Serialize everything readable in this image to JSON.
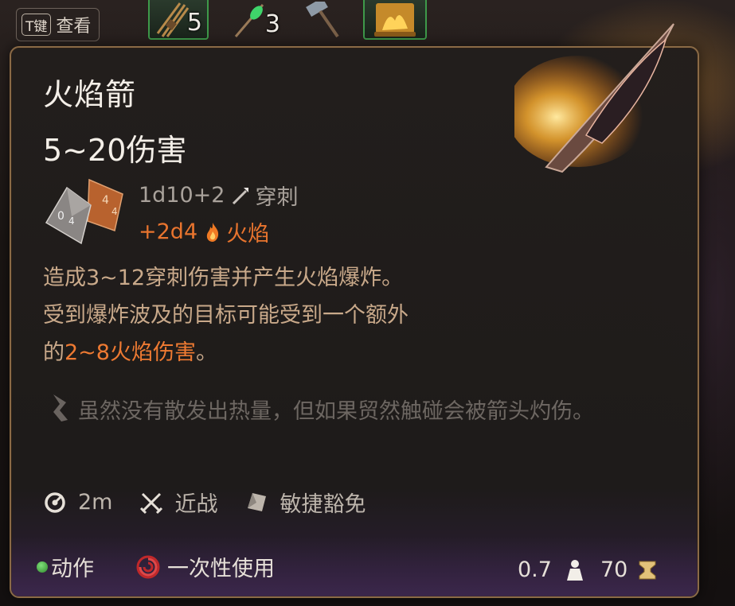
{
  "hotbar": {
    "inspect_key": "T键",
    "inspect_label": "查看",
    "slots": [
      {
        "icon": "arrow-bundle-icon",
        "count": "5"
      },
      {
        "icon": "potion-icon",
        "count": "3"
      },
      {
        "icon": "hammer-icon",
        "count": ""
      },
      {
        "icon": "scroll-icon",
        "count": ""
      }
    ]
  },
  "tooltip": {
    "title": "火焰箭",
    "damage_range": "5~20伤害",
    "base_damage": {
      "dice": "1d10+2",
      "type": "穿刺",
      "icon": "piercing-icon"
    },
    "extra_damage": {
      "dice": "+2d4",
      "type": "火焰",
      "icon": "fire-icon"
    },
    "description": {
      "line1": "造成3~12穿刺伤害并产生火焰爆炸。",
      "line2": "受到爆炸波及的目标可能受到一个额外",
      "line3_prefix": "的",
      "line3_highlight": "2~8火焰伤害",
      "line3_suffix": "。"
    },
    "flavor": "虽然没有散发出热量，但如果贸然触碰会被箭头灼伤。",
    "properties": {
      "range": "2m",
      "attack_type": "近战",
      "save": "敏捷豁免"
    },
    "footer": {
      "action": "动作",
      "usage": "一次性使用",
      "weight": "0.7",
      "price": "70"
    }
  },
  "colors": {
    "title": "#f4efe8",
    "fire_accent": "#e8742e",
    "description": "#c9a98a",
    "border": "#8a6a46",
    "action_green": "#3fa83a"
  }
}
